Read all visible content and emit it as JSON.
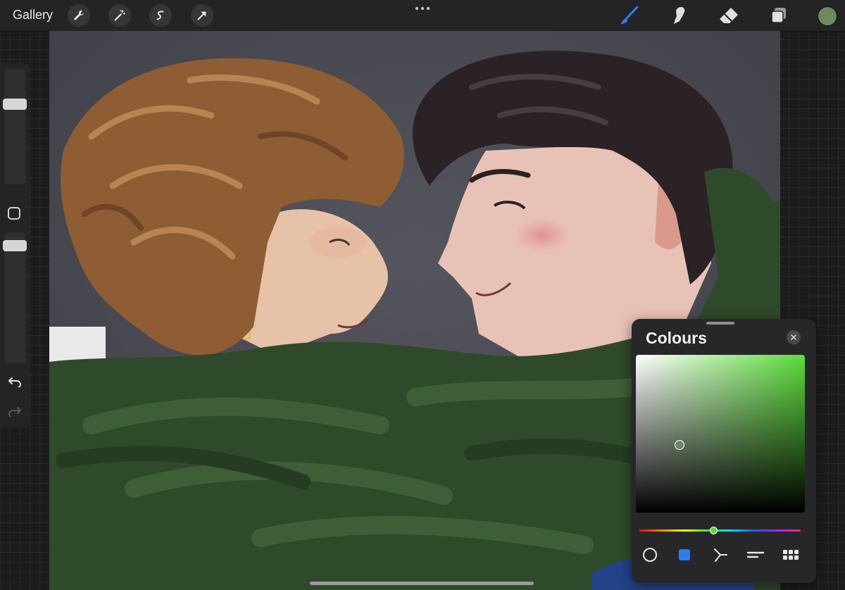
{
  "topbar": {
    "gallery_label": "Gallery",
    "left_tools": [
      "wrench-icon",
      "magic-wand-icon",
      "selection-icon",
      "transform-arrow-icon"
    ],
    "right_tools": [
      "brush-icon",
      "smudge-icon",
      "eraser-icon",
      "layers-icon"
    ],
    "active_tool": "brush-icon",
    "accent_color": "#2f7cf6",
    "current_colour": "#6b8a5f"
  },
  "sidebar": {
    "brush_size_level": 0.83,
    "opacity_level": 0.67
  },
  "colours_panel": {
    "title": "Colours",
    "current_colour": "#6b8a5f",
    "hue_color": "#5bdc3a",
    "hue_position": 0.46,
    "modes": [
      "disc",
      "classic",
      "harmony",
      "value",
      "palettes"
    ],
    "active_mode": "classic"
  }
}
